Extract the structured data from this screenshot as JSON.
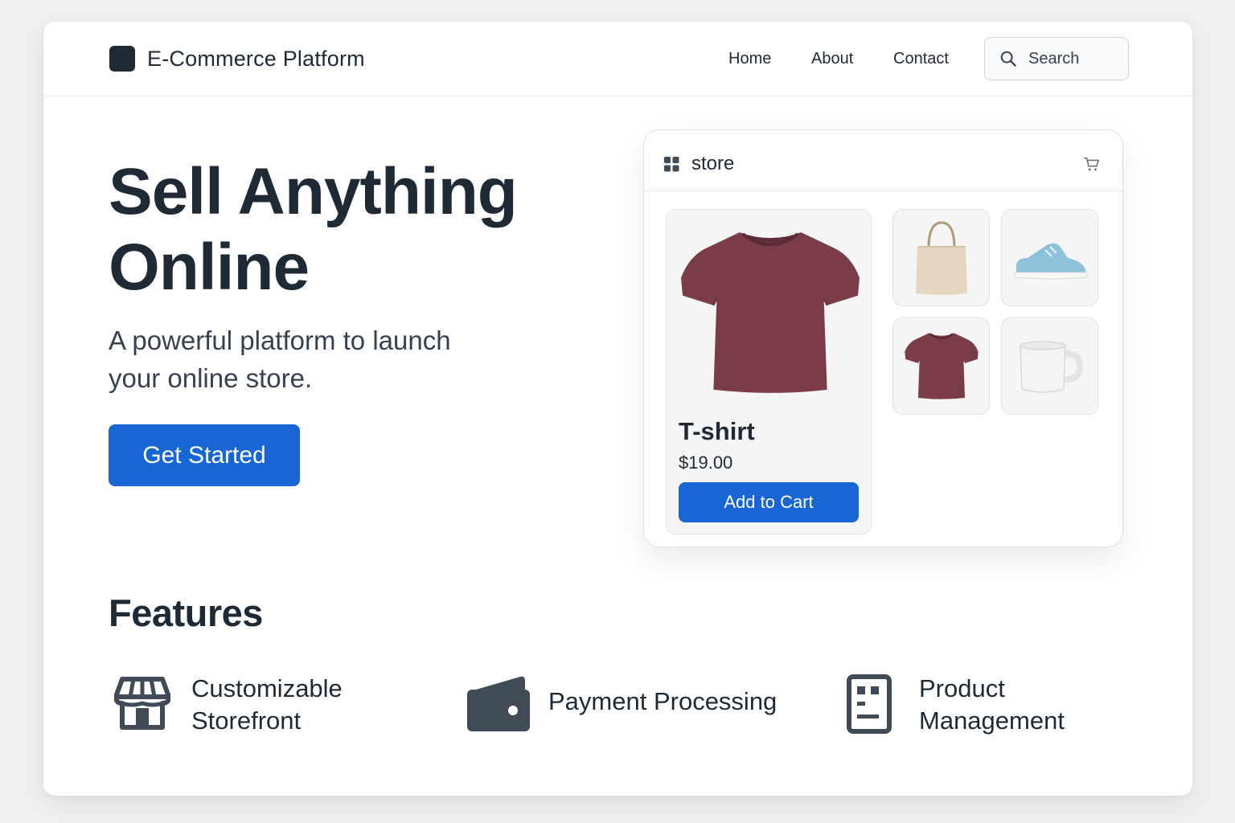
{
  "header": {
    "brand": "E-Commerce Platform",
    "nav": [
      "Home",
      "About",
      "Contact"
    ],
    "search_placeholder": "Search"
  },
  "hero": {
    "title_line1": "Sell Anything",
    "title_line2": "Online",
    "subtitle_line1": "A powerful platform to launch",
    "subtitle_line2": "your online store.",
    "cta": "Get Started"
  },
  "store_preview": {
    "title": "store",
    "featured": {
      "name": "T-shirt",
      "price": "$19.00",
      "button": "Add to Cart"
    },
    "thumbnails": [
      "tote-bag",
      "sneaker",
      "t-shirt",
      "mug"
    ]
  },
  "features": {
    "title": "Features",
    "items": [
      {
        "icon": "storefront-icon",
        "line1": "Customizable",
        "line2": "Storefront"
      },
      {
        "icon": "wallet-icon",
        "line1": "Payment Processing",
        "line2": ""
      },
      {
        "icon": "document-icon",
        "line1": "Product",
        "line2": "Management"
      }
    ]
  },
  "colors": {
    "accent": "#1766d3",
    "dark": "#1f2a37",
    "icon": "#414b57",
    "tshirt": "#7a3d48"
  }
}
